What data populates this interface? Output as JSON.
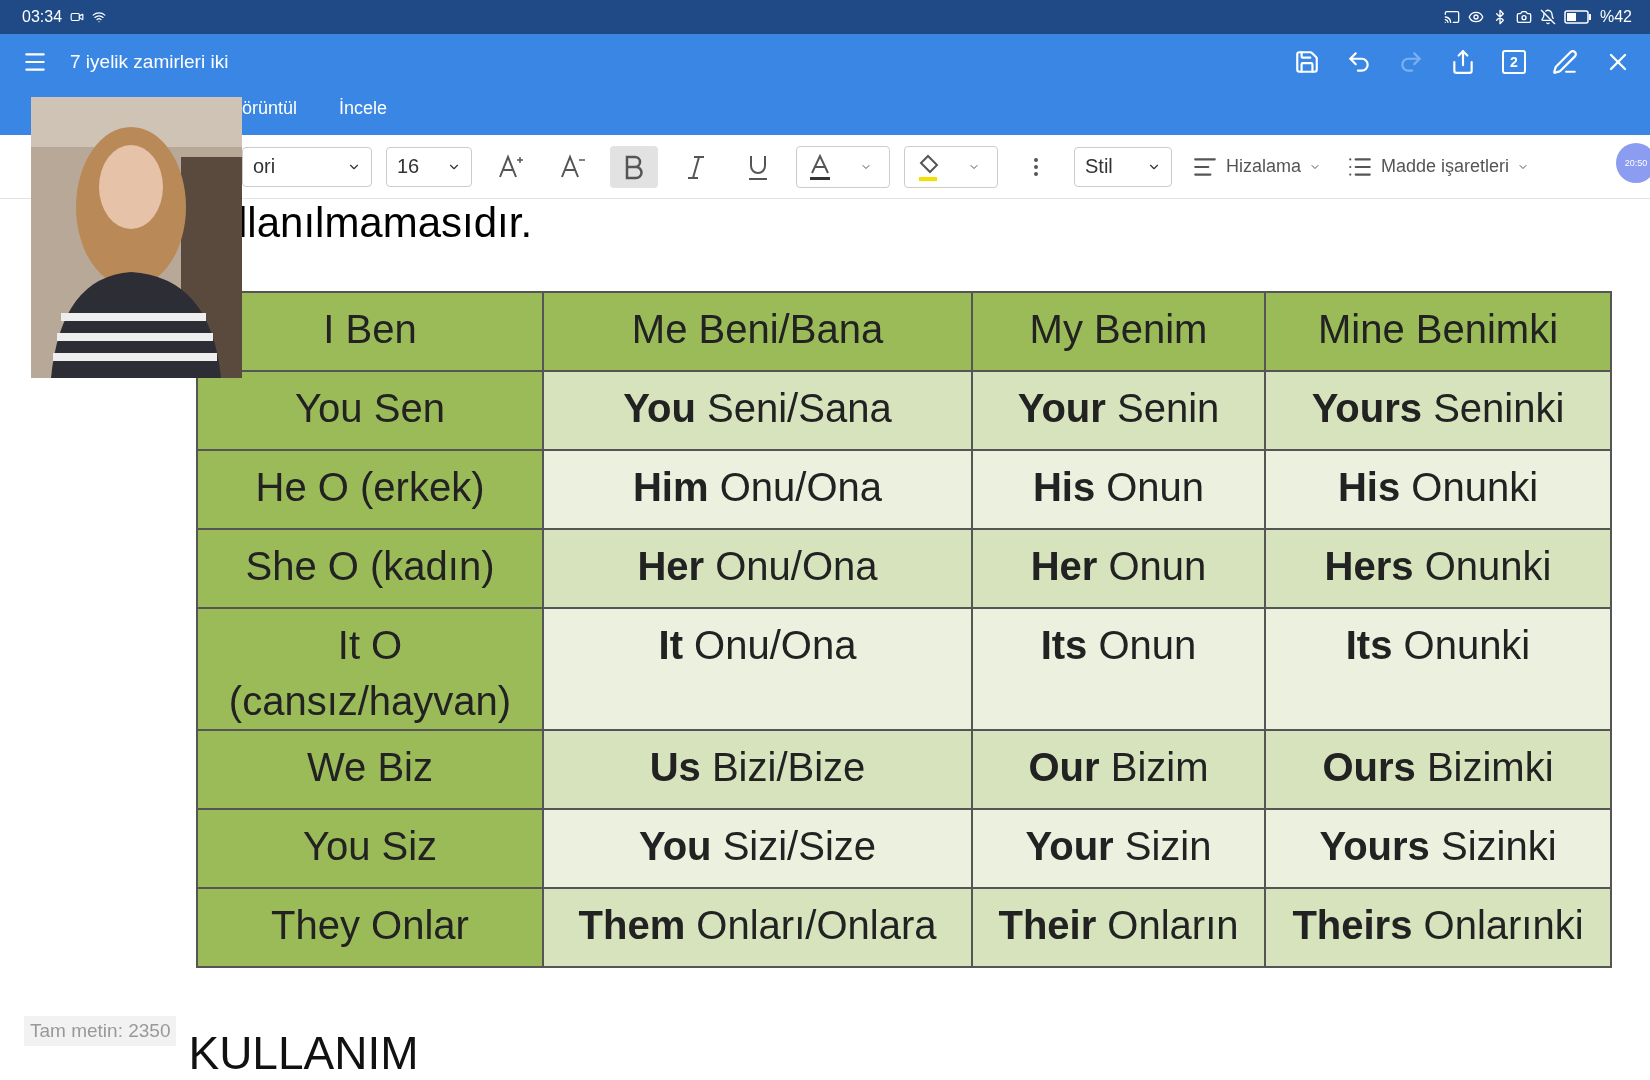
{
  "status_bar": {
    "time": "03:34",
    "battery": "%42"
  },
  "window": {
    "title": "7 iyelik zamirleri iki",
    "page_count": "2"
  },
  "tabs": [
    {
      "label": "örüntül",
      "selected": false
    },
    {
      "label": "İncele",
      "selected": false
    }
  ],
  "toolbar": {
    "font": "ori",
    "size": "16",
    "bold": true,
    "italic": false,
    "underline": false,
    "style": "Stil",
    "align": "Hizalama",
    "bullets": "Madde işaretleri",
    "bubble": "20:50"
  },
  "document": {
    "heading_fragment": "llanılmamasıdır.",
    "table": {
      "rows": [
        [
          "I  Ben",
          "Me Beni/Bana",
          "My Benim",
          "Mine Benimki"
        ],
        [
          "You Sen",
          "**You** Seni/Sana",
          "**Your** Senin",
          "**Yours** Seninki"
        ],
        [
          "He O (erkek)",
          "**Him** Onu/Ona",
          "**His** Onun",
          "**His** Onunki"
        ],
        [
          "She O (kadın)",
          "**Her** Onu/Ona",
          "**Her** Onun",
          "**Hers** Onunki"
        ],
        [
          "It O (cansız/hayvan)",
          "**It** Onu/Ona",
          "**Its** Onun",
          "**Its** Onunki"
        ],
        [
          "We Biz",
          "**Us** Bizi/Bize",
          "**Our** Bizim",
          "**Ours** Bizimki"
        ],
        [
          "You Siz",
          "**You** Sizi/Size",
          "**Your** Sizin",
          "**Yours** Sizinki"
        ],
        [
          "They Onlar",
          "**Them** Onları/Onlara",
          "**Their** Onların",
          "**Theirs** Onlarınki"
        ]
      ]
    },
    "word_count": "Tam metin: 2350",
    "next_heading": "KULLANIM"
  }
}
